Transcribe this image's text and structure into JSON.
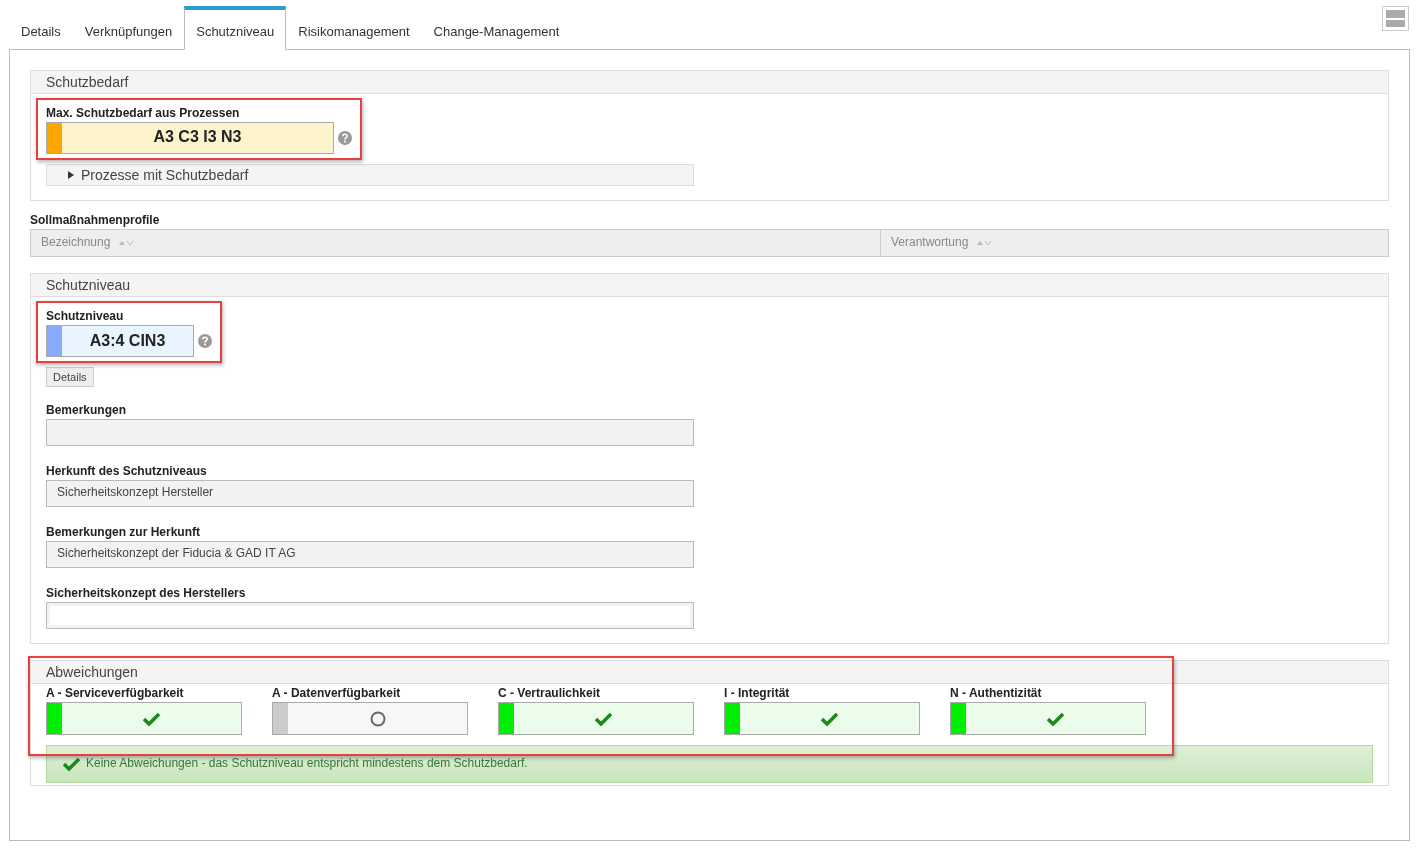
{
  "tabs": [
    {
      "label": "Details",
      "selected": false
    },
    {
      "label": "Verknüpfungen",
      "selected": false
    },
    {
      "label": "Schutzniveau",
      "selected": true
    },
    {
      "label": "Risikomanagement",
      "selected": false
    },
    {
      "label": "Change-Management",
      "selected": false
    }
  ],
  "schutzbedarf": {
    "title": "Schutzbedarf",
    "highlighted": true,
    "label": "Max. Schutzbedarf aus Prozessen",
    "value": "A3 C3 I3 N3",
    "color": "#ffa500",
    "expander": {
      "label": "Prozesse mit Schutzbedarf",
      "expanded": false
    }
  },
  "sollmassnahmenprofile": {
    "title": "Sollmaßnahmenprofile",
    "columns": [
      "Bezeichnung",
      "Verantwortung"
    ]
  },
  "schutzniveau": {
    "title": "Schutzniveau",
    "highlighted": true,
    "label": "Schutzniveau",
    "value": "A3:4 CIN3",
    "color": "#88aaff",
    "details_button": "Details",
    "fields": [
      {
        "label": "Bemerkungen"
      },
      {
        "label": "Herkunft des Schutzniveaus",
        "value": "Sicherheitskonzept Hersteller"
      },
      {
        "label": "Bemerkungen zur Herkunft",
        "value": "Sicherheitskonzept der Fiducia & GAD IT AG"
      },
      {
        "label": "Sicherheitskonzept des Herstellers",
        "kind": "white"
      }
    ]
  },
  "abweichungen": {
    "title": "Abweichungen",
    "highlighted": true,
    "items": [
      {
        "label": "A - Serviceverfügbarkeit",
        "kind": "ok",
        "color": "#00ee00"
      },
      {
        "label": "A - Datenverfügbarkeit",
        "kind": "none",
        "color": "#cccccc"
      },
      {
        "label": "C - Vertraulichkeit",
        "kind": "ok",
        "color": "#00ee00"
      },
      {
        "label": "I - Integrität",
        "kind": "ok",
        "color": "#00ee00"
      },
      {
        "label": "N - Authentizität",
        "kind": "ok",
        "color": "#00ee00"
      }
    ],
    "message": "Keine Abweichungen - das Schutzniveau entspricht mindestens dem Schutzbedarf."
  }
}
